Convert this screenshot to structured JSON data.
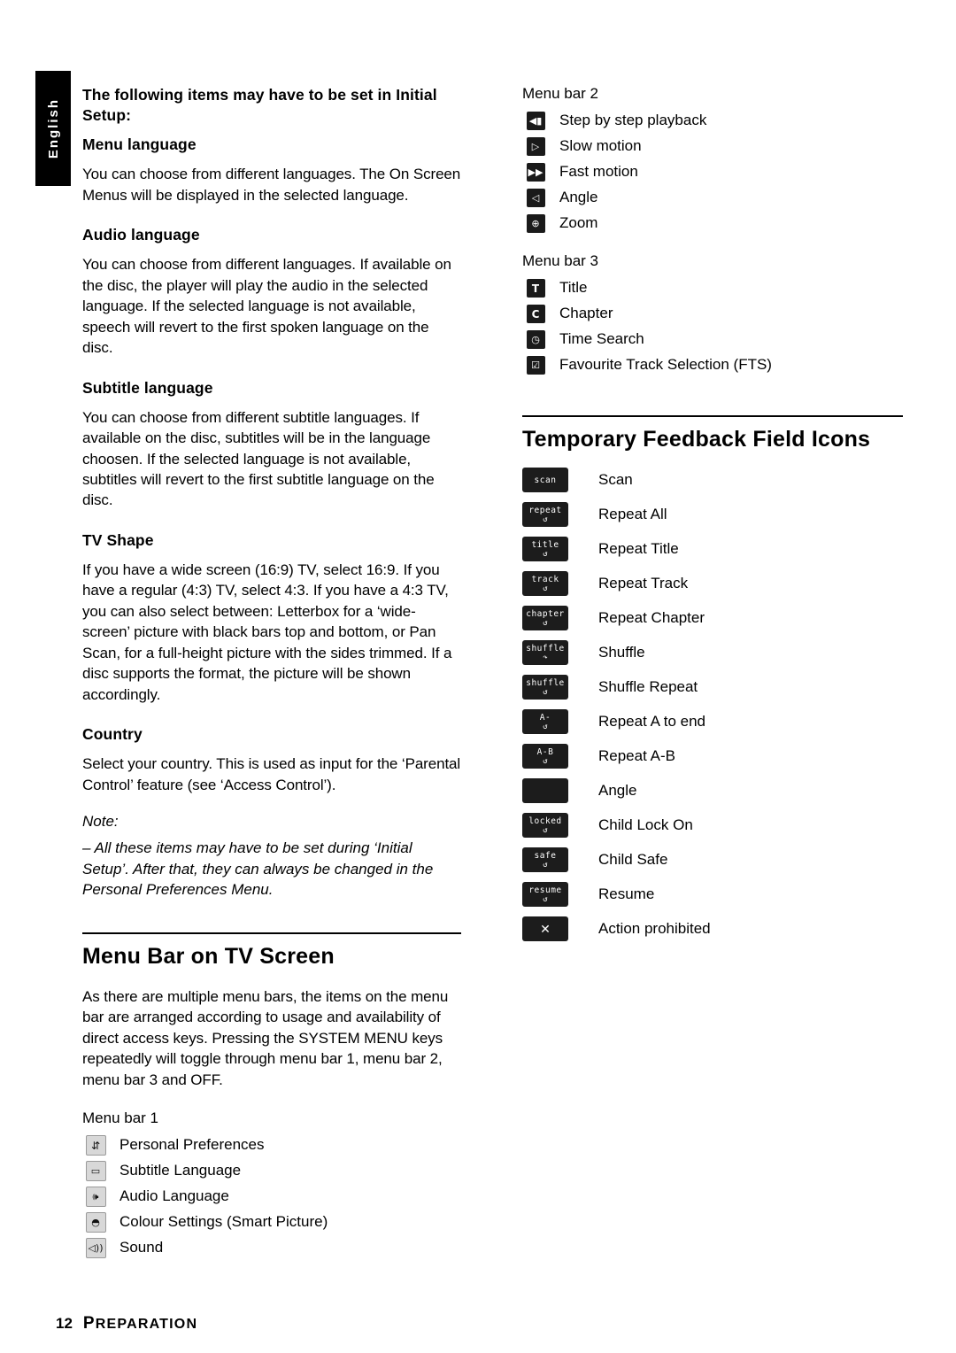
{
  "sidebar_tab": {
    "label": "English"
  },
  "left_column": {
    "intro_heading": "The following items may have to be set in Initial Setup:",
    "sections": [
      {
        "heading": "Menu language",
        "body": "You can choose from different languages. The On Screen Menus will be displayed in the selected language."
      },
      {
        "heading": "Audio language",
        "body": "You can choose from different languages. If available on the disc, the player will play the audio in the selected language. If the selected language is not available, speech will revert to the first spoken language on the disc."
      },
      {
        "heading": "Subtitle language",
        "body": "You can choose from different subtitle languages. If available on the disc, subtitles will be in the language choosen. If the selected language is not available, subtitles will revert to the first subtitle language on the disc."
      },
      {
        "heading": "TV Shape",
        "body": "If you have a wide screen (16:9) TV, select 16:9. If you have a regular (4:3) TV, select 4:3. If you have a 4:3 TV, you can also select between: Letterbox for a ‘wide-screen’ picture with black bars top and bottom, or Pan Scan, for a full-height picture with the sides trimmed. If a disc supports the format, the picture will be shown accordingly."
      },
      {
        "heading": "Country",
        "body": "Select your country. This is used as input for the ‘Parental Control’ feature (see ‘Access Control’)."
      }
    ],
    "note": {
      "title": "Note:",
      "body": "–  All these items may have to be set during ‘Initial Setup’. After that, they can always be changed in the Personal Preferences Menu."
    },
    "menu_bar_section": {
      "title": "Menu Bar on TV Screen",
      "body": "As there are multiple menu bars, the items on the menu bar are arranged according to usage and availability of direct access keys. Pressing the SYSTEM MENU keys repeatedly will toggle through menu bar 1, menu bar 2, menu bar 3 and OFF.",
      "bar1_label": "Menu bar 1",
      "bar1_items": [
        {
          "icon": "personal-preferences-icon",
          "label": "Personal Preferences"
        },
        {
          "icon": "subtitle-language-icon",
          "label": "Subtitle Language"
        },
        {
          "icon": "audio-language-icon",
          "label": "Audio Language"
        },
        {
          "icon": "colour-settings-icon",
          "label": "Colour Settings (Smart Picture)"
        },
        {
          "icon": "sound-icon",
          "label": "Sound"
        }
      ]
    }
  },
  "right_column": {
    "bar2_label": "Menu bar 2",
    "bar2_items": [
      {
        "icon": "step-by-step-icon",
        "label": "Step by step playback"
      },
      {
        "icon": "slow-motion-icon",
        "label": "Slow motion"
      },
      {
        "icon": "fast-motion-icon",
        "label": "Fast motion"
      },
      {
        "icon": "angle-icon",
        "label": "Angle"
      },
      {
        "icon": "zoom-icon",
        "label": "Zoom"
      }
    ],
    "bar3_label": "Menu bar 3",
    "bar3_items": [
      {
        "icon": "title-icon",
        "label": "Title"
      },
      {
        "icon": "chapter-icon",
        "label": "Chapter"
      },
      {
        "icon": "time-search-icon",
        "label": "Time Search"
      },
      {
        "icon": "fts-icon",
        "label": "Favourite Track Selection (FTS)"
      }
    ],
    "tff": {
      "title": "Temporary Feedback Field Icons",
      "items": [
        {
          "chip_text": "scan",
          "chip_sub": "",
          "label": "Scan"
        },
        {
          "chip_text": "repeat",
          "chip_sub": "↺",
          "label": "Repeat All"
        },
        {
          "chip_text": "title",
          "chip_sub": "↺",
          "label": "Repeat Title"
        },
        {
          "chip_text": "track",
          "chip_sub": "↺",
          "label": "Repeat Track"
        },
        {
          "chip_text": "chapter",
          "chip_sub": "↺",
          "label": "Repeat Chapter"
        },
        {
          "chip_text": "shuffle",
          "chip_sub": "↷",
          "label": "Shuffle"
        },
        {
          "chip_text": "shuffle",
          "chip_sub": "↺",
          "label": "Shuffle Repeat"
        },
        {
          "chip_text": "A-",
          "chip_sub": "↺",
          "label": "Repeat A to end"
        },
        {
          "chip_text": "A-B",
          "chip_sub": "↺",
          "label": "Repeat A-B"
        },
        {
          "chip_text": "",
          "chip_sub": "",
          "label": "Angle"
        },
        {
          "chip_text": "locked",
          "chip_sub": "↺",
          "label": "Child Lock On"
        },
        {
          "chip_text": "safe",
          "chip_sub": "↺",
          "label": "Child Safe"
        },
        {
          "chip_text": "resume",
          "chip_sub": "↺",
          "label": "Resume"
        },
        {
          "chip_text": "",
          "chip_sub": "",
          "label": "Action prohibited"
        }
      ]
    }
  },
  "footer": {
    "page_number": "12",
    "section_cap": "P",
    "section_rest": "REPARATION"
  }
}
